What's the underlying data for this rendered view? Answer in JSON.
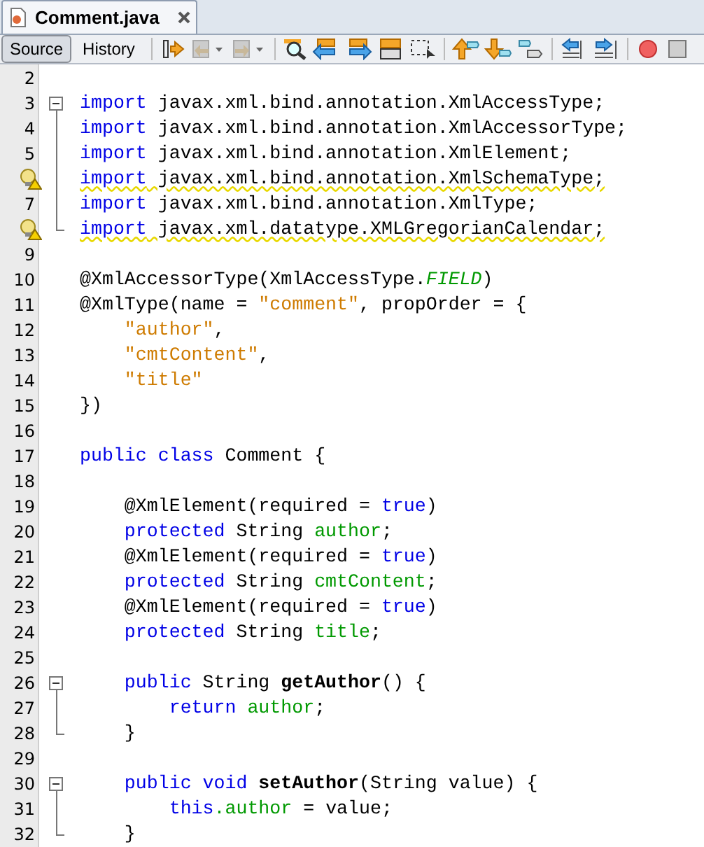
{
  "editor_tab": {
    "title": "Comment.java"
  },
  "view_toggle": [
    {
      "label": "Source",
      "selected": true
    },
    {
      "label": "History",
      "selected": false
    }
  ],
  "lines": [
    {
      "number": "2"
    },
    {
      "number": "3",
      "fold_start": true,
      "tokens": [
        {
          "kind": "keyword",
          "text": "import"
        },
        {
          "kind": "plain",
          "text": " javax.xml.bind.annotation.XmlAccessType;"
        }
      ]
    },
    {
      "number": "4",
      "fold_inside": true,
      "tokens": [
        {
          "kind": "keyword",
          "text": "import"
        },
        {
          "kind": "plain",
          "text": " javax.xml.bind.annotation.XmlAccessorType;"
        }
      ]
    },
    {
      "number": "5",
      "fold_inside": true,
      "tokens": [
        {
          "kind": "keyword",
          "text": "import"
        },
        {
          "kind": "plain",
          "text": " javax.xml.bind.annotation.XmlElement;"
        }
      ]
    },
    {
      "fold_inside": true,
      "warning": true,
      "tokens": [
        {
          "kind": "keyword",
          "text": "import"
        },
        {
          "kind": "plain",
          "text": " javax.xml.bind.annotation.XmlSchemaType;"
        }
      ]
    },
    {
      "number": "7",
      "fold_inside": true,
      "tokens": [
        {
          "kind": "keyword",
          "text": "import"
        },
        {
          "kind": "plain",
          "text": " javax.xml.bind.annotation.XmlType;"
        }
      ]
    },
    {
      "fold_end": true,
      "warning": true,
      "tokens": [
        {
          "kind": "keyword",
          "text": "import"
        },
        {
          "kind": "plain",
          "text": " javax.xml.datatype.XMLGregorianCalendar;"
        }
      ]
    },
    {
      "number": "9"
    },
    {
      "number": "10",
      "tokens": [
        {
          "kind": "plain",
          "text": "@XmlAccessorType(XmlAccessType."
        },
        {
          "kind": "constant",
          "text": "FIELD"
        },
        {
          "kind": "plain",
          "text": ")"
        }
      ]
    },
    {
      "number": "11",
      "tokens": [
        {
          "kind": "plain",
          "text": "@XmlType(name = "
        },
        {
          "kind": "string",
          "text": "\"comment\""
        },
        {
          "kind": "plain",
          "text": ", propOrder = {"
        }
      ]
    },
    {
      "number": "12",
      "tokens": [
        {
          "kind": "string",
          "text": "    \"author\""
        },
        {
          "kind": "plain",
          "text": ","
        }
      ]
    },
    {
      "number": "13",
      "tokens": [
        {
          "kind": "string",
          "text": "    \"cmtContent\""
        },
        {
          "kind": "plain",
          "text": ","
        }
      ]
    },
    {
      "number": "14",
      "tokens": [
        {
          "kind": "string",
          "text": "    \"title\""
        }
      ]
    },
    {
      "number": "15",
      "tokens": [
        {
          "kind": "plain",
          "text": "})"
        }
      ]
    },
    {
      "number": "16"
    },
    {
      "number": "17",
      "tokens": [
        {
          "kind": "keyword",
          "text": "public class"
        },
        {
          "kind": "plain",
          "text": " Comment {"
        }
      ]
    },
    {
      "number": "18"
    },
    {
      "number": "19",
      "tokens": [
        {
          "kind": "plain",
          "text": "    @XmlElement(required = "
        },
        {
          "kind": "keyword",
          "text": "true"
        },
        {
          "kind": "plain",
          "text": ")"
        }
      ]
    },
    {
      "number": "20",
      "tokens": [
        {
          "kind": "keyword",
          "text": "    protected"
        },
        {
          "kind": "plain",
          "text": " String "
        },
        {
          "kind": "field",
          "text": "author"
        },
        {
          "kind": "plain",
          "text": ";"
        }
      ]
    },
    {
      "number": "21",
      "tokens": [
        {
          "kind": "plain",
          "text": "    @XmlElement(required = "
        },
        {
          "kind": "keyword",
          "text": "true"
        },
        {
          "kind": "plain",
          "text": ")"
        }
      ]
    },
    {
      "number": "22",
      "tokens": [
        {
          "kind": "keyword",
          "text": "    protected"
        },
        {
          "kind": "plain",
          "text": " String "
        },
        {
          "kind": "field",
          "text": "cmtContent"
        },
        {
          "kind": "plain",
          "text": ";"
        }
      ]
    },
    {
      "number": "23",
      "tokens": [
        {
          "kind": "plain",
          "text": "    @XmlElement(required = "
        },
        {
          "kind": "keyword",
          "text": "true"
        },
        {
          "kind": "plain",
          "text": ")"
        }
      ]
    },
    {
      "number": "24",
      "tokens": [
        {
          "kind": "keyword",
          "text": "    protected"
        },
        {
          "kind": "plain",
          "text": " String "
        },
        {
          "kind": "field",
          "text": "title"
        },
        {
          "kind": "plain",
          "text": ";"
        }
      ]
    },
    {
      "number": "25"
    },
    {
      "number": "26",
      "fold_start": true,
      "tokens": [
        {
          "kind": "keyword",
          "text": "    public"
        },
        {
          "kind": "plain",
          "text": " String "
        },
        {
          "kind": "method",
          "text": "getAuthor"
        },
        {
          "kind": "plain",
          "text": "() {"
        }
      ]
    },
    {
      "number": "27",
      "fold_inside": true,
      "tokens": [
        {
          "kind": "keyword",
          "text": "        return"
        },
        {
          "kind": "field",
          "text": " author"
        },
        {
          "kind": "plain",
          "text": ";"
        }
      ]
    },
    {
      "number": "28",
      "fold_end": true,
      "tokens": [
        {
          "kind": "plain",
          "text": "    }"
        }
      ]
    },
    {
      "number": "29"
    },
    {
      "number": "30",
      "fold_start": true,
      "tokens": [
        {
          "kind": "keyword",
          "text": "    public void"
        },
        {
          "kind": "method",
          "text": " setAuthor"
        },
        {
          "kind": "plain",
          "text": "(String value) {"
        }
      ]
    },
    {
      "number": "31",
      "fold_inside": true,
      "tokens": [
        {
          "kind": "keyword",
          "text": "        this"
        },
        {
          "kind": "field",
          "text": ".author"
        },
        {
          "kind": "plain",
          "text": " = value;"
        }
      ]
    },
    {
      "number": "32",
      "fold_end": true,
      "tokens": [
        {
          "kind": "plain",
          "text": "    }"
        }
      ]
    }
  ]
}
